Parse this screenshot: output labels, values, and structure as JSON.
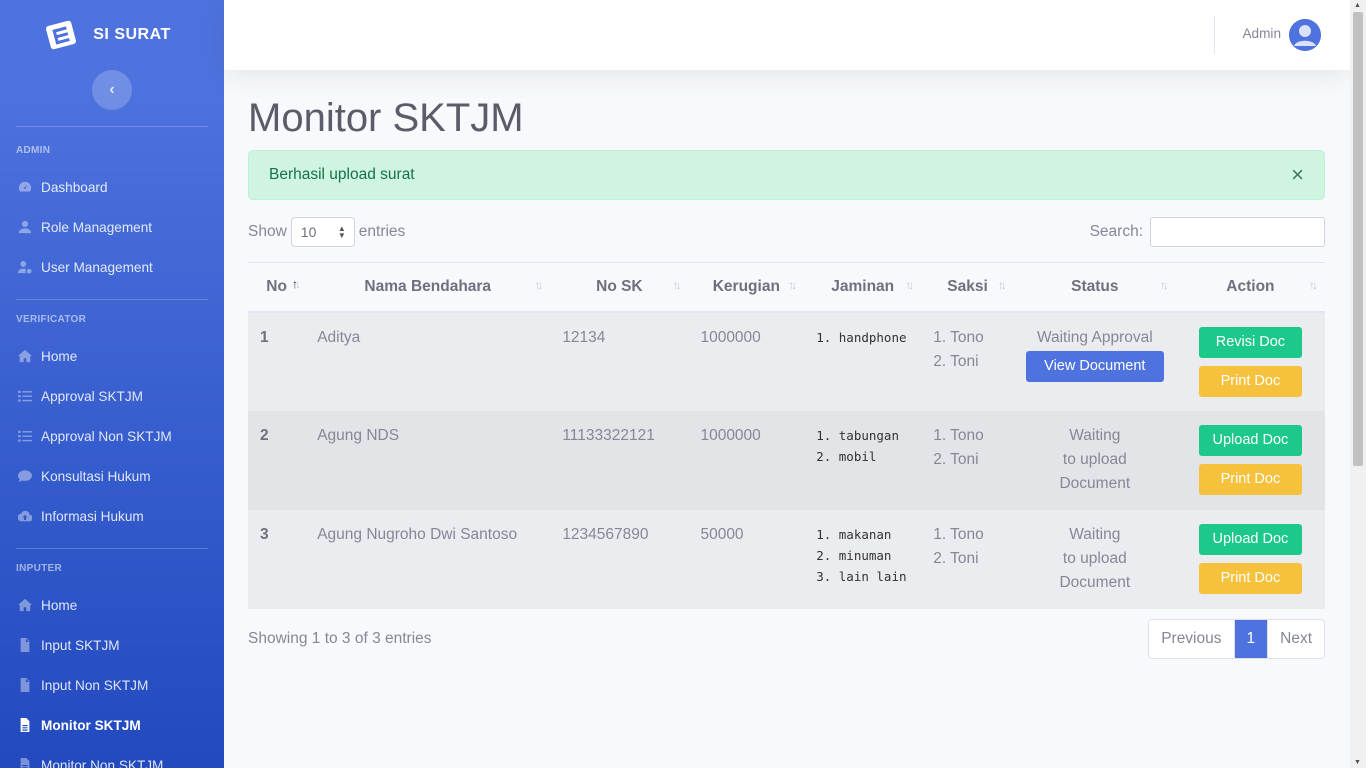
{
  "brand": {
    "name": "SI SURAT"
  },
  "sidebar": {
    "sections": [
      {
        "heading": "ADMIN",
        "items": [
          {
            "label": "Dashboard",
            "icon": "dashboard-icon"
          },
          {
            "label": "Role Management",
            "icon": "user-icon"
          },
          {
            "label": "User Management",
            "icon": "users-cog-icon"
          }
        ]
      },
      {
        "heading": "VERIFICATOR",
        "items": [
          {
            "label": "Home",
            "icon": "home-icon"
          },
          {
            "label": "Approval SKTJM",
            "icon": "tasks-icon"
          },
          {
            "label": "Approval Non SKTJM",
            "icon": "tasks-icon"
          },
          {
            "label": "Konsultasi Hukum",
            "icon": "comment-icon"
          },
          {
            "label": "Informasi Hukum",
            "icon": "cloud-upload-icon"
          }
        ]
      },
      {
        "heading": "INPUTER",
        "items": [
          {
            "label": "Home",
            "icon": "home-icon"
          },
          {
            "label": "Input SKTJM",
            "icon": "file-icon"
          },
          {
            "label": "Input Non SKTJM",
            "icon": "file-icon"
          },
          {
            "label": "Monitor SKTJM",
            "icon": "file-alt-icon",
            "active": true
          },
          {
            "label": "Monitor Non SKTJM",
            "icon": "file-alt-icon"
          }
        ]
      }
    ]
  },
  "topbar": {
    "user_name": "Admin"
  },
  "page": {
    "title": "Monitor SKTJM",
    "alert": "Berhasil upload surat",
    "alert_close": "×",
    "show_label": "Show",
    "entries_label": "entries",
    "page_length": "10",
    "search_label": "Search:",
    "search_value": "",
    "info": "Showing 1 to 3 of 3 entries"
  },
  "table": {
    "columns": [
      "No",
      "Nama Bendahara",
      "No SK",
      "Kerugian",
      "Jaminan",
      "Saksi",
      "Status",
      "Action"
    ],
    "rows": [
      {
        "no": "1",
        "nama": "Aditya",
        "no_sk": "12134",
        "kerugian": "1000000",
        "jaminan": [
          "1. handphone"
        ],
        "saksi": [
          "1. Tono",
          "2. Toni"
        ],
        "status": "Waiting Approval",
        "status_button": "View Document",
        "actions": [
          "Revisi Doc",
          "Print Doc"
        ]
      },
      {
        "no": "2",
        "nama": "Agung NDS",
        "no_sk": "11133322121",
        "kerugian": "1000000",
        "jaminan": [
          "1. tabungan",
          "2. mobil"
        ],
        "saksi": [
          "1. Tono",
          "2. Toni"
        ],
        "status_lines": [
          "Waiting",
          "to upload",
          "Document"
        ],
        "actions": [
          "Upload Doc",
          "Print Doc"
        ]
      },
      {
        "no": "3",
        "nama": "Agung Nugroho Dwi Santoso",
        "no_sk": "1234567890",
        "kerugian": "50000",
        "jaminan": [
          "1. makanan",
          "2. minuman",
          "3. lain lain"
        ],
        "saksi": [
          "1. Tono",
          "2. Toni"
        ],
        "status_lines": [
          "Waiting",
          "to upload",
          "Document"
        ],
        "actions": [
          "Upload Doc",
          "Print Doc"
        ]
      }
    ]
  },
  "pagination": {
    "previous": "Previous",
    "current": "1",
    "next": "Next"
  },
  "colors": {
    "primary": "#4e73df",
    "success": "#1cc88a",
    "warning": "#f6c23e",
    "alert_bg": "#d0f4e2"
  }
}
